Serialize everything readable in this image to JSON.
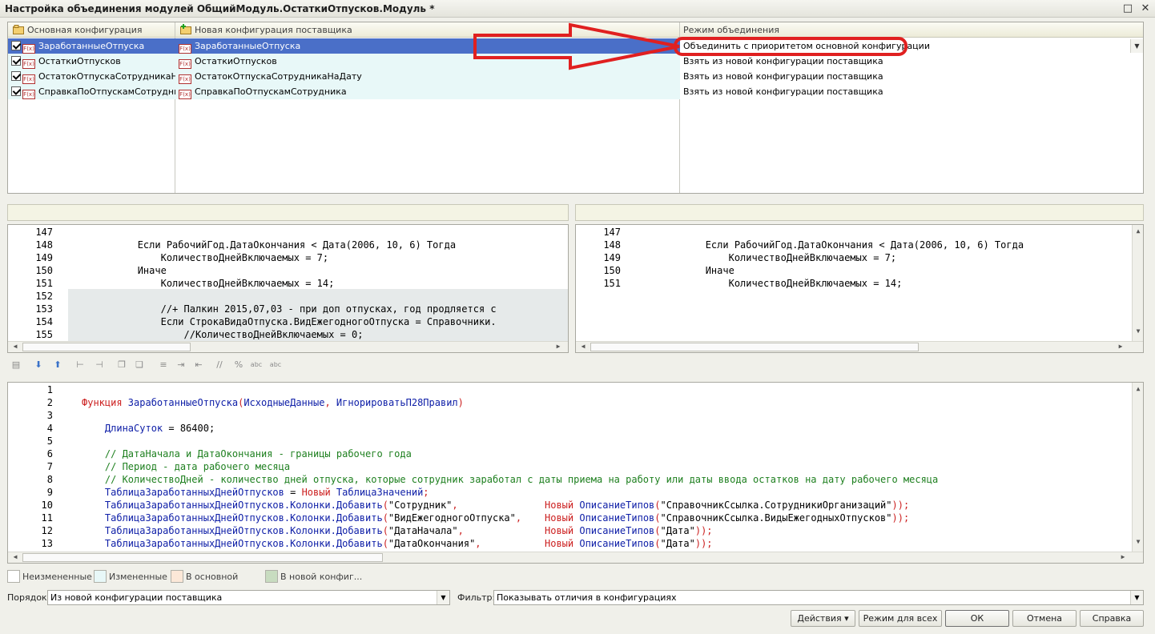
{
  "window": {
    "title": "Настройка объединения модулей ОбщийМодуль.ОстаткиОтпусков.Модуль *",
    "maximize_symbol": "□",
    "close_symbol": "✕"
  },
  "grid": {
    "columns": [
      "Основная конфигурация",
      "Новая конфигурация поставщика",
      "Режим объединения"
    ],
    "rows": [
      {
        "main": "ЗаработанныеОтпуска",
        "vendor": "ЗаработанныеОтпуска",
        "mode": "Объединить с приоритетом основной конфигурации",
        "selected": true
      },
      {
        "main": "ОстаткиОтпусков",
        "vendor": "ОстаткиОтпусков",
        "mode": "Взять из новой конфигурации поставщика"
      },
      {
        "main": "ОстатокОтпускаСотрудникаНа...",
        "vendor": "ОстатокОтпускаСотрудникаНаДату",
        "mode": "Взять из новой конфигурации поставщика"
      },
      {
        "main": "СправкаПоОтпускамСотрудни...",
        "vendor": "СправкаПоОтпускамСотрудника",
        "mode": "Взять из новой конфигурации поставщика"
      }
    ],
    "fx_icon_text": "F(x)",
    "dropdown_symbol": "▼"
  },
  "left_code": [
    {
      "n": "147",
      "code": ""
    },
    {
      "n": "148",
      "code": "            Если РабочийГод.ДатаОкончания < Дата(2006, 10, 6) Тогда"
    },
    {
      "n": "149",
      "code": "                КоличествоДнейВключаемых = 7;"
    },
    {
      "n": "150",
      "code": "            Иначе"
    },
    {
      "n": "151",
      "code": "                КоличествоДнейВключаемых = 14;"
    },
    {
      "n": "152",
      "code": ""
    },
    {
      "n": "153",
      "code": "                //+ Палкин 2015,07,03 - при доп отпусках, год продляется с"
    },
    {
      "n": "154",
      "code": "                Если СтрокаВидаОтпуска.ВидЕжегодногоОтпуска = Справочники."
    },
    {
      "n": "155",
      "code": "                    //КоличествоДнейВключаемых = 0;"
    }
  ],
  "right_code": [
    {
      "n": "147",
      "code": ""
    },
    {
      "n": "148",
      "code": "            Если РабочийГод.ДатаОкончания < Дата(2006, 10, 6) Тогда"
    },
    {
      "n": "149",
      "code": "                КоличествоДнейВключаемых = 7;"
    },
    {
      "n": "150",
      "code": "            Иначе"
    },
    {
      "n": "151",
      "code": "                КоличествоДнейВключаемых = 14;"
    }
  ],
  "bottom_code": [
    {
      "n": "1",
      "parts": []
    },
    {
      "n": "2",
      "parts": [
        [
          "kw",
          "Функция "
        ],
        [
          "id",
          "ЗаработанныеОтпуска"
        ],
        [
          "kw",
          "("
        ],
        [
          "id",
          "ИсходныеДанные"
        ],
        [
          "kw",
          ", "
        ],
        [
          "id",
          "ИгнорироватьП28Правил"
        ],
        [
          "kw",
          ")"
        ]
      ]
    },
    {
      "n": "3",
      "parts": []
    },
    {
      "n": "4",
      "parts": [
        [
          "id",
          "    ДлинаСуток"
        ],
        [
          "str",
          " = 86400;"
        ]
      ]
    },
    {
      "n": "5",
      "parts": []
    },
    {
      "n": "6",
      "parts": [
        [
          "cm",
          "    // ДатаНачала и ДатаОкончания - границы рабочего года"
        ]
      ]
    },
    {
      "n": "7",
      "parts": [
        [
          "cm",
          "    // Период - дата рабочего месяца"
        ]
      ]
    },
    {
      "n": "8",
      "parts": [
        [
          "cm",
          "    // КоличествоДней - количество дней отпуска, которые сотрудник заработал с даты приема на работу или даты ввода остатков на дату рабочего месяца"
        ]
      ]
    },
    {
      "n": "9",
      "parts": [
        [
          "id",
          "    ТаблицаЗаработанныхДнейОтпусков"
        ],
        [
          "str",
          " = "
        ],
        [
          "kw",
          "Новый "
        ],
        [
          "id",
          "ТаблицаЗначений"
        ],
        [
          "kw",
          ";"
        ]
      ]
    },
    {
      "n": "10",
      "parts": [
        [
          "id",
          "    ТаблицаЗаработанныхДнейОтпусков.Колонки.Добавить"
        ],
        [
          "kw",
          "("
        ],
        [
          "str",
          "\"Сотрудник\""
        ],
        [
          "kw",
          ",               Новый "
        ],
        [
          "id",
          "ОписаниеТипов"
        ],
        [
          "kw",
          "("
        ],
        [
          "str",
          "\"СправочникСсылка.СотрудникиОрганизаций\""
        ],
        [
          "kw",
          "));"
        ]
      ]
    },
    {
      "n": "11",
      "parts": [
        [
          "id",
          "    ТаблицаЗаработанныхДнейОтпусков.Колонки.Добавить"
        ],
        [
          "kw",
          "("
        ],
        [
          "str",
          "\"ВидЕжегодногоОтпуска\""
        ],
        [
          "kw",
          ",    Новый "
        ],
        [
          "id",
          "ОписаниеТипов"
        ],
        [
          "kw",
          "("
        ],
        [
          "str",
          "\"СправочникСсылка.ВидыЕжегодныхОтпусков\""
        ],
        [
          "kw",
          "));"
        ]
      ]
    },
    {
      "n": "12",
      "parts": [
        [
          "id",
          "    ТаблицаЗаработанныхДнейОтпусков.Колонки.Добавить"
        ],
        [
          "kw",
          "("
        ],
        [
          "str",
          "\"ДатаНачала\""
        ],
        [
          "kw",
          ",              Новый "
        ],
        [
          "id",
          "ОписаниеТипов"
        ],
        [
          "kw",
          "("
        ],
        [
          "str",
          "\"Дата\""
        ],
        [
          "kw",
          "));"
        ]
      ]
    },
    {
      "n": "13",
      "parts": [
        [
          "id",
          "    ТаблицаЗаработанныхДнейОтпусков.Колонки.Добавить"
        ],
        [
          "kw",
          "("
        ],
        [
          "str",
          "\"ДатаОкончания\""
        ],
        [
          "kw",
          ",           Новый "
        ],
        [
          "id",
          "ОписаниеТипов"
        ],
        [
          "kw",
          "("
        ],
        [
          "str",
          "\"Дата\""
        ],
        [
          "kw",
          "));"
        ]
      ]
    }
  ],
  "legend": [
    "Неизмененные",
    "Измененные",
    "В основной",
    "В новой конфиг..."
  ],
  "legend_colors": [
    "#ffffff",
    "#e8f8f8",
    "#fce8d8",
    "#c8dcc0"
  ],
  "order": {
    "label": "Порядок:",
    "value": "Из новой конфигурации поставщика"
  },
  "filter": {
    "label": "Фильтр:",
    "value": "Показывать отличия в конфигурациях"
  },
  "buttons": {
    "actions": "Действия ▾",
    "mode_all": "Режим для всех",
    "ok": "ОК",
    "cancel": "Отмена",
    "help": "Справка"
  },
  "colors": {
    "selection": "#4a6fc8",
    "changed": "#e8f8f8",
    "annotation": "#e02020"
  }
}
